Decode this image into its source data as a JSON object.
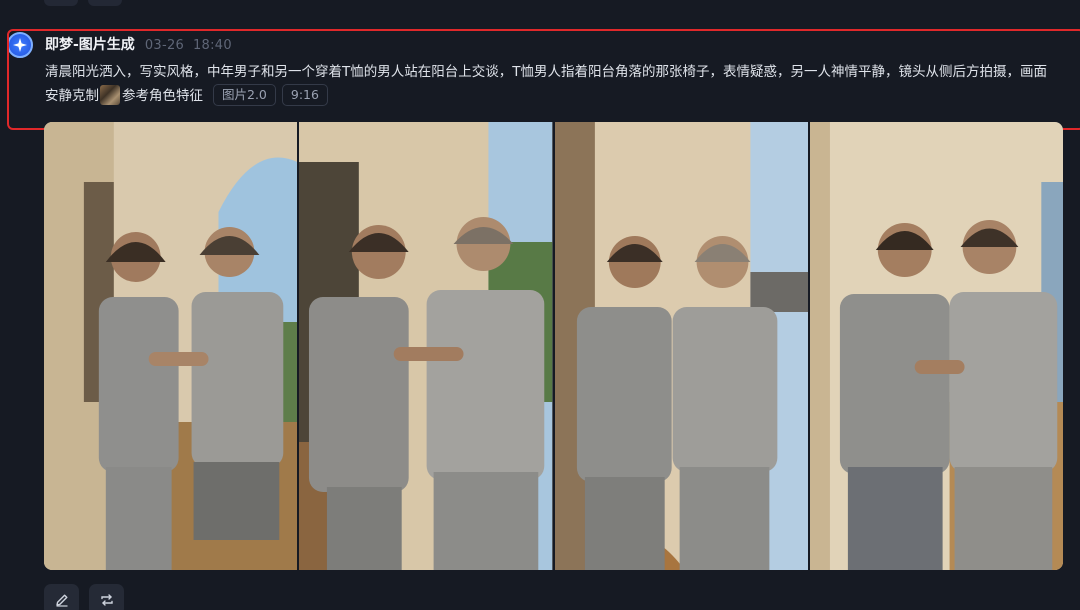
{
  "message": {
    "app_name": "即梦-图片生成",
    "date": "03-26",
    "time": "18:40",
    "prompt_text": "清晨阳光洒入，写实风格，中年男子和另一个穿着T恤的男人站在阳台上交谈，T恤男人指着阳台角落的那张椅子，表情疑惑，另一人神情平静，镜头从侧后方拍摄，画面安静克制",
    "reference_label": "参考角色特征",
    "model_tag": "图片2.0",
    "ratio_tag": "9:16",
    "avatar_icon": "jimeng-star-icon",
    "highlight_color": "#e0282a"
  },
  "images": [
    {
      "name": "generated-image-1"
    },
    {
      "name": "generated-image-2"
    },
    {
      "name": "generated-image-3"
    },
    {
      "name": "generated-image-4"
    }
  ],
  "actions": [
    {
      "name": "edit-button",
      "icon": "pencil-icon"
    },
    {
      "name": "regenerate-button",
      "icon": "repeat-icon"
    }
  ]
}
